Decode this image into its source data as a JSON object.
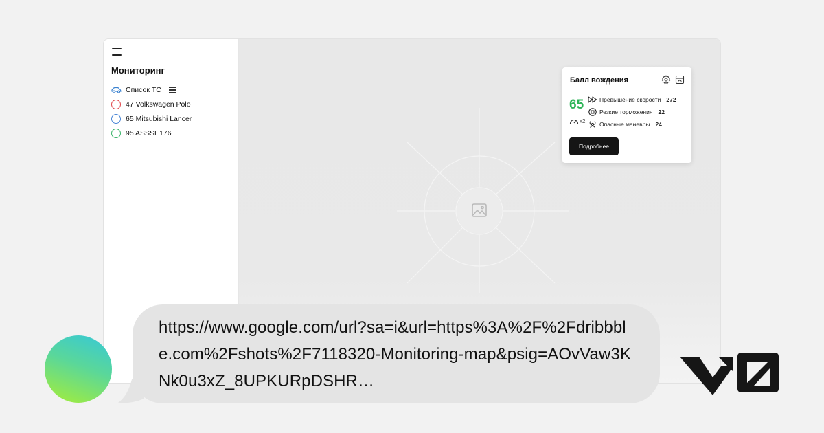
{
  "sidebar": {
    "title": "Мониторинг",
    "list_label": "Список ТС",
    "vehicles": [
      {
        "label": "47 Volkswagen Polo",
        "color": "#e0474c"
      },
      {
        "label": "65 Mitsubishi Lancer",
        "color": "#4a86d6"
      },
      {
        "label": "95 ASSSE176",
        "color": "#3bb56b"
      }
    ]
  },
  "card": {
    "title": "Балл вождения",
    "score": "65",
    "multiplier": "x2",
    "metrics": [
      {
        "label": "Превышение скорости",
        "value": "272",
        "icon": "fast-forward-icon"
      },
      {
        "label": "Резкие торможения",
        "value": "22",
        "icon": "brake-icon"
      },
      {
        "label": "Опасные маневры",
        "value": "24",
        "icon": "hazard-icon"
      }
    ],
    "button_label": "Подробнее"
  },
  "bubble": {
    "text": "https://www.google.com/url?sa=i&url=https%3A%2F%2Fdribbble.com%2Fshots%2F7118320-Monitoring-map&psig=AOvVaw3KNk0u3xZ_8UPKURpDSHR…"
  },
  "colors": {
    "score_green": "#2db457",
    "button_dark": "#151515",
    "bubble_bg": "#e4e4e4"
  }
}
